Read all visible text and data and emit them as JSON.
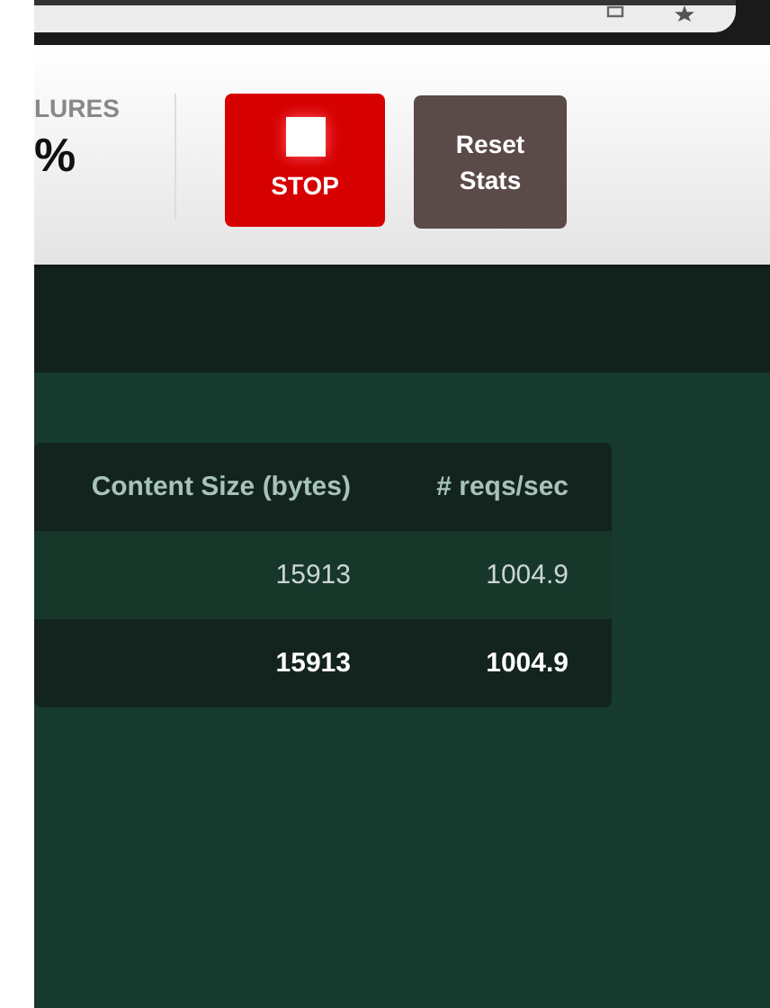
{
  "stat": {
    "label": "LURES",
    "value": "%"
  },
  "buttons": [
    {
      "kind": "stop",
      "label": "STOP"
    },
    {
      "kind": "reset",
      "label": "Reset Stats"
    }
  ],
  "table": {
    "columns": [
      "Content Size (bytes)",
      "# reqs/sec"
    ],
    "rows": [
      {
        "kind": "data",
        "cells": [
          "15913",
          "1004.9"
        ]
      },
      {
        "kind": "total",
        "cells": [
          "15913",
          "1004.9"
        ]
      }
    ]
  }
}
